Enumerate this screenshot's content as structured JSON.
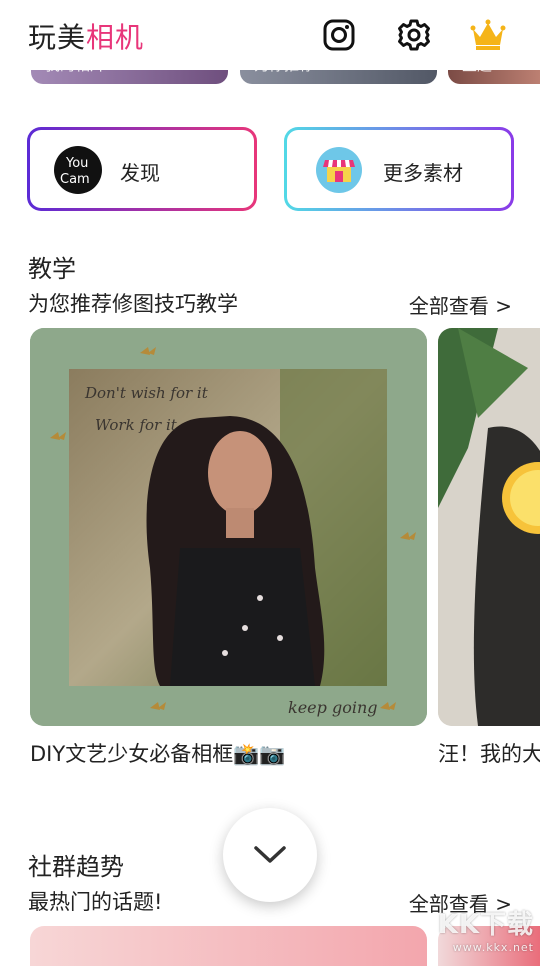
{
  "header": {
    "title_part1": "玩美",
    "title_part2": "相机",
    "accent_color": "#e8367a",
    "icons": [
      "instagram-icon",
      "settings-gear-icon",
      "premium-crown-icon"
    ]
  },
  "top_strip": {
    "items": [
      {
        "label": "我的相片"
      },
      {
        "label": "为你推荐"
      },
      {
        "label": "主题"
      }
    ]
  },
  "features": {
    "discover": {
      "label": "发现",
      "logo_text_1": "You",
      "logo_text_2": "Cam"
    },
    "materials": {
      "label": "更多素材"
    }
  },
  "tutorials": {
    "title": "教学",
    "subtitle": "为您推荐修图技巧教学",
    "see_all": "全部查看 >",
    "cards": [
      {
        "caption": "DIY文艺少女必备相框📸📷",
        "overlay_line1": "Don't wish for it",
        "overlay_line2": "Work for it",
        "overlay_bottom": "keep going"
      },
      {
        "caption": "汪！我的大"
      }
    ]
  },
  "community": {
    "title": "社群趋势",
    "subtitle": "最热门的话题!",
    "see_all": "全部查看 >"
  },
  "watermark": {
    "text": "KK下载",
    "small": "www.kkx.net"
  }
}
